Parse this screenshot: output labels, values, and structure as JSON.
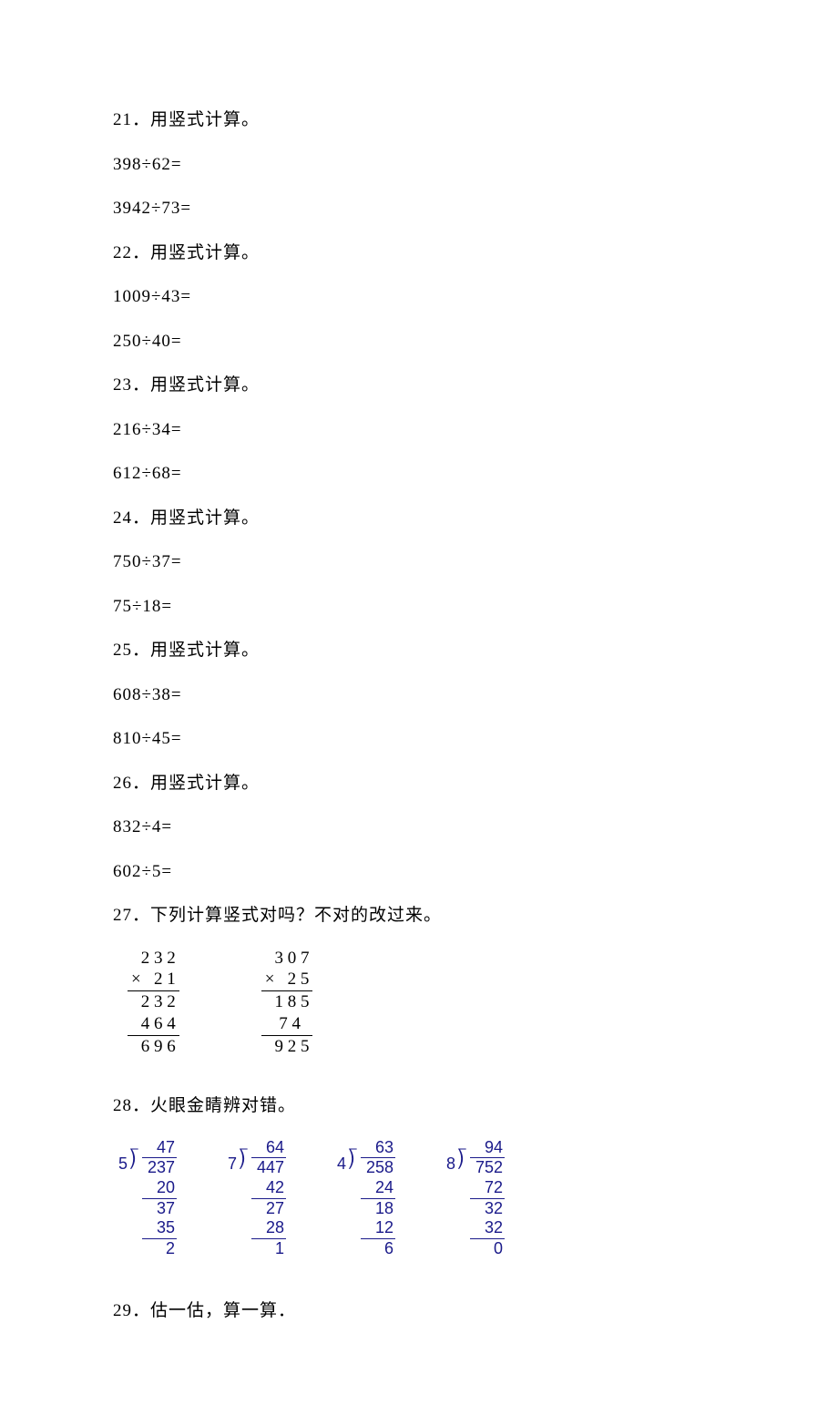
{
  "lines": {
    "p21_title": "21．用竖式计算。",
    "p21_a": "398÷62=",
    "p21_b": "3942÷73=",
    "p22_title": "22．用竖式计算。",
    "p22_a": "1009÷43=",
    "p22_b": "250÷40=",
    "p23_title": "23．用竖式计算。",
    "p23_a": "216÷34=",
    "p23_b": "612÷68=",
    "p24_title": "24．用竖式计算。",
    "p24_a": "750÷37=",
    "p24_b": "75÷18=",
    "p25_title": "25．用竖式计算。",
    "p25_a": "608÷38=",
    "p25_b": "810÷45=",
    "p26_title": "26．用竖式计算。",
    "p26_a": "832÷4=",
    "p26_b": "602÷5=",
    "p27_title": "27．下列计算竖式对吗？不对的改过来。",
    "p28_title": "28．火眼金睛辨对错。",
    "p29_title": "29．估一估，算一算．"
  },
  "p27": [
    {
      "r1": "2 3 2",
      "r2": "×   2 1",
      "r3": "2 3 2",
      "r4": "4 6 4",
      "r5": "6 9 6"
    },
    {
      "r1": "3 0 7",
      "r2": "×   2 5",
      "r3": "1 8 5",
      "r4": "7 4  ",
      "r5": "9 2 5"
    }
  ],
  "p28": [
    {
      "divisor": "5",
      "quot": "47",
      "dividend": "237",
      "s1": "20",
      "b1": "37",
      "s2": "35",
      "rem": "2"
    },
    {
      "divisor": "7",
      "quot": "64",
      "dividend": "447",
      "s1": "42",
      "b1": "27",
      "s2": "28",
      "rem": "1"
    },
    {
      "divisor": "4",
      "quot": "63",
      "dividend": "258",
      "s1": "24",
      "b1": "18",
      "s2": "12",
      "rem": "6"
    },
    {
      "divisor": "8",
      "quot": "94",
      "dividend": "752",
      "s1": "72",
      "b1": "32",
      "s2": "32",
      "rem": "0"
    }
  ]
}
